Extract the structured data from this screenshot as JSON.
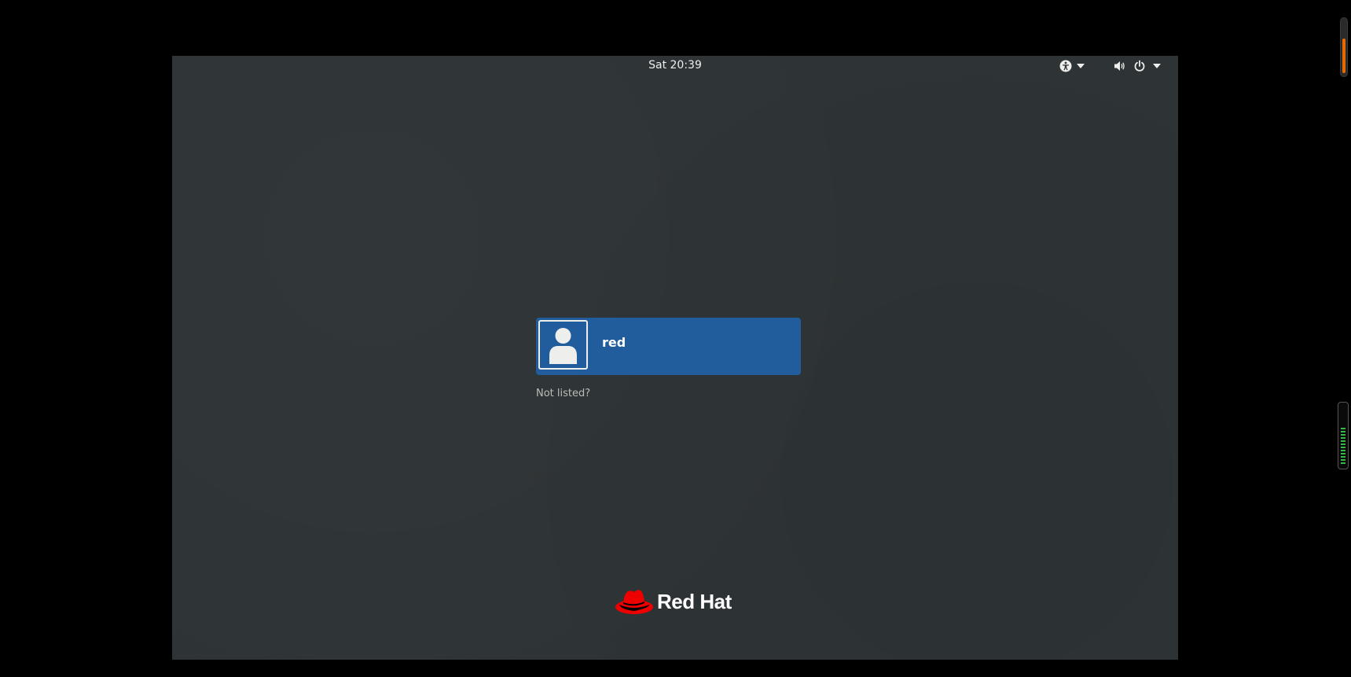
{
  "top_bar": {
    "clock": "Sat 20:39",
    "icons": {
      "accessibility": "accessibility-icon",
      "a11y_arrow": "chevron-down-icon",
      "volume": "volume-icon",
      "power": "power-icon",
      "system_arrow": "chevron-down-icon"
    }
  },
  "user_list": {
    "users": [
      {
        "name": "red",
        "avatar": "user-silhouette-icon"
      }
    ],
    "not_listed_label": "Not listed?"
  },
  "branding": {
    "logo": "red-hat-fedora-logo",
    "text": "Red Hat"
  },
  "colors": {
    "background": "#2e3436",
    "selection": "#215d9c",
    "brand_red": "#ee0000",
    "text": "#eeeeec",
    "muted_text": "#babdb6"
  }
}
